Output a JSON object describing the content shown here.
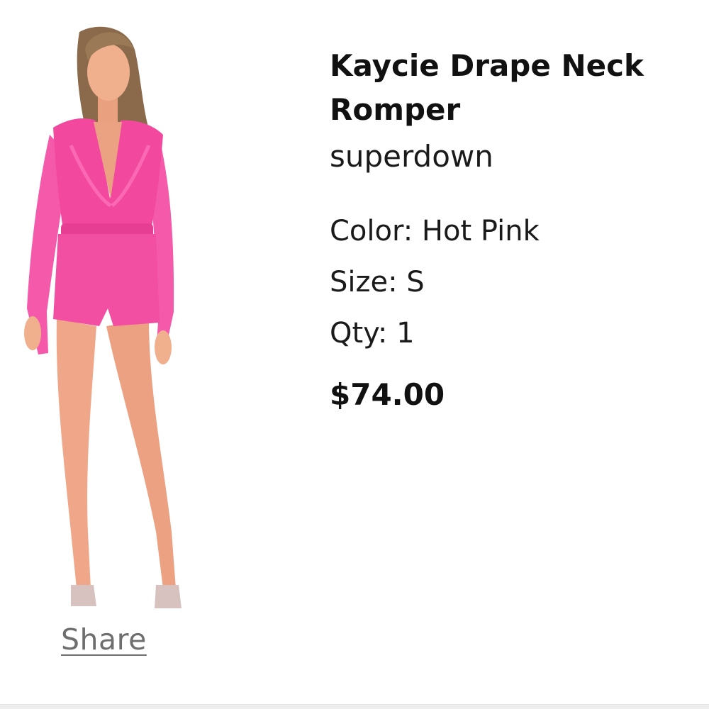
{
  "product": {
    "title": "Kaycie Drape Neck Romper",
    "brand": "superdown",
    "color_label": "Color: Hot Pink",
    "size_label": "Size: S",
    "qty_label": "Qty: 1",
    "price": "$74.00",
    "share_label": "Share",
    "accent_color": "#f2499f"
  }
}
